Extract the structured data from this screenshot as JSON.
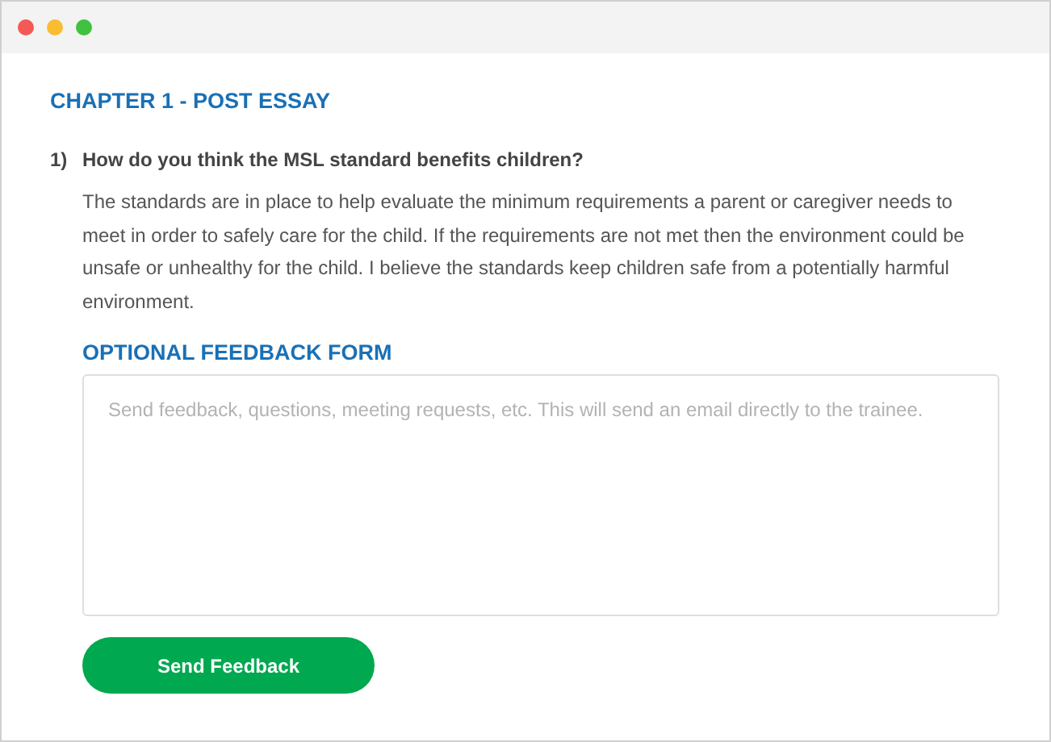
{
  "window": {
    "controls": [
      {
        "color": "#f45a55"
      },
      {
        "color": "#f8bd31"
      },
      {
        "color": "#3fc23f"
      }
    ]
  },
  "title": "CHAPTER 1 - POST ESSAY",
  "question": {
    "number": "1)",
    "text": "How do you think the MSL standard benefits children?",
    "answer": "The standards are in place to help evaluate the minimum requirements a parent or caregiver needs to meet in order to safely care for the child. If the requirements are not met then the environment could be unsafe or unhealthy for the child. I believe the standards keep children safe from a potentially harmful environment."
  },
  "feedback": {
    "heading": "OPTIONAL FEEDBACK FORM",
    "placeholder": "Send feedback, questions, meeting requests, etc. This will send an email directly to the trainee.",
    "button": "Send Feedback"
  }
}
